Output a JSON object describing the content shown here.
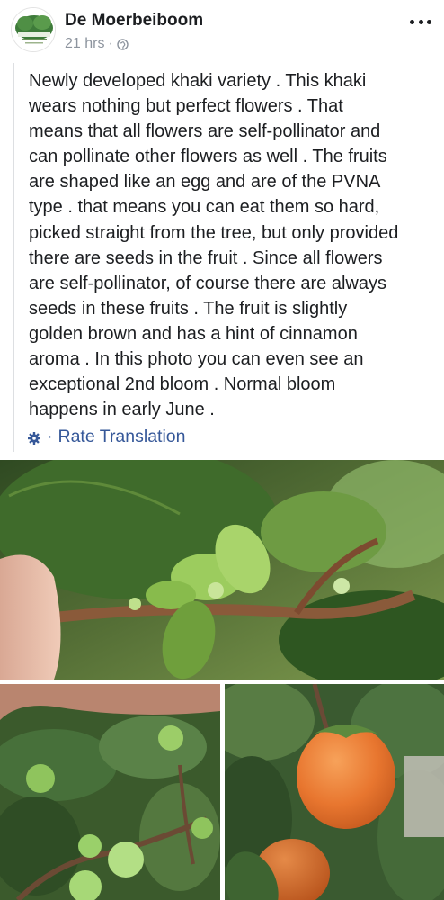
{
  "post": {
    "page_name": "De Moerbeiboom",
    "timestamp": "21 hrs",
    "meta_separator": "·",
    "audience_icon": "globe-icon",
    "more_icon": "more-options-icon",
    "text": "Newly developed khaki variety . This khaki\nwears nothing but perfect flowers . That\nmeans that all flowers are self-pollinator and\ncan pollinate other flowers as well . The fruits\nare shaped like an egg and are of the PVNA\ntype . that means you can eat them so hard,\npicked straight from the tree, but only provided\nthere are seeds in the fruit . Since all flowers\nare self-pollinator, of course there are always\nseeds in these fruits . The fruit is slightly\ngolden brown and has a hint of cinnamon\naroma . In this photo you can even see an\nexceptional 2nd bloom . Normal bloom\nhappens in early June .",
    "translation": {
      "icon": "gear-icon",
      "separator": "·",
      "label": "Rate Translation"
    }
  },
  "photos": [
    {
      "name": "khaki-branch-bloom-photo",
      "subject": "persimmon branch with green flower buds"
    },
    {
      "name": "green-fruits-photo",
      "subject": "cluster of young green persimmon fruits"
    },
    {
      "name": "ripe-fruit-photo",
      "subject": "ripe orange persimmon fruit among leaves"
    }
  ],
  "colors": {
    "link": "#365899",
    "meta": "#8d949e",
    "text": "#1c1e21",
    "quote_bar": "#dddfe2"
  }
}
